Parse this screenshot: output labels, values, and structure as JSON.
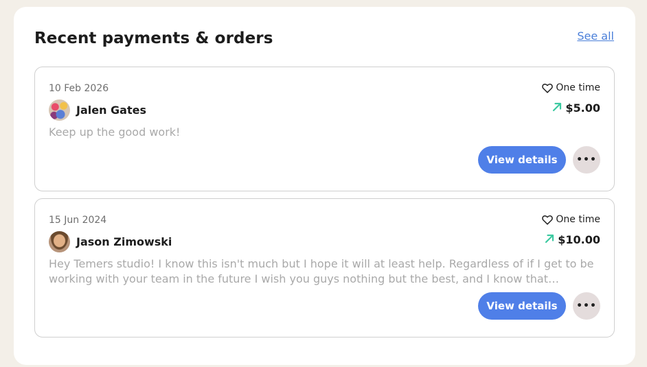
{
  "section": {
    "title": "Recent payments & orders",
    "see_all_label": "See all"
  },
  "payments": [
    {
      "date": "10 Feb 2026",
      "type": "One time",
      "name": "Jalen Gates",
      "amount": "$5.00",
      "message": "Keep up the good work!",
      "view_label": "View details",
      "more_label": "•••"
    },
    {
      "date": "15 Jun 2024",
      "type": "One time",
      "name": "Jason Zimowski",
      "amount": "$10.00",
      "message": "Hey Temers studio! I know this isn't much but I hope it will at least help. Regardless of if I get to be working with your team in the future I wish you guys nothing but the best, and I know that Dragon'...",
      "view_label": "View details",
      "more_label": "•••"
    }
  ],
  "icons": {
    "type_icon": "heart-icon",
    "amount_icon": "arrow-up-right-icon",
    "arrow_color": "#3cc9a0",
    "accent": "#4f7fe8"
  }
}
